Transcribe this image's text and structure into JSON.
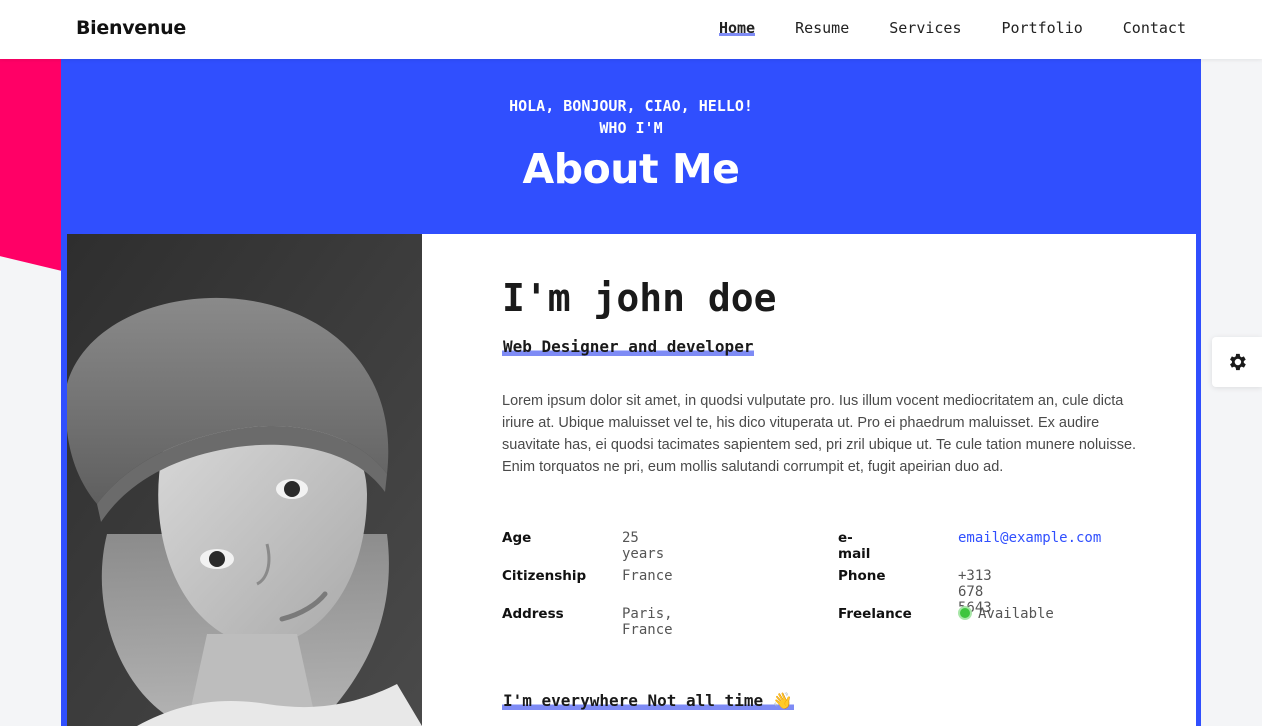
{
  "header": {
    "brand": "Bienvenue",
    "nav": [
      "Home",
      "Resume",
      "Services",
      "Portfolio",
      "Contact"
    ],
    "active_nav": "Home"
  },
  "hero": {
    "greeting": "HOLA, BONJOUR, CIAO, HELLO!",
    "subtitle": "WHO I'M",
    "title": "About Me"
  },
  "about": {
    "name": "I'm john doe",
    "role": "Web Designer and developer",
    "bio": "Lorem ipsum dolor sit amet, in quodsi vulputate pro. Ius illum vocent mediocritatem an, cule dicta iriure at. Ubique maluisset vel te, his dico vituperata ut. Pro ei phaedrum maluisset. Ex audire suavitate has, ei quodsi tacimates sapientem sed, pri zril ubique ut. Te cule tation munere noluisse. Enim torquatos ne pri, eum mollis salutandi corrumpit et, fugit apeirian duo ad.",
    "info": {
      "age_label": "Age",
      "age": "25 years",
      "citizenship_label": "Citizenship",
      "citizenship": "France",
      "address_label": "Address",
      "address": "Paris, France",
      "email_label": "e-mail",
      "email": "email@example.com",
      "phone_label": "Phone",
      "phone": "+313 678 5643",
      "freelance_label": "Freelance",
      "freelance": "Available"
    },
    "social_title": "I'm everywhere Not all time 👋"
  },
  "colors": {
    "accent": "#304ffe",
    "pink": "#ff0066",
    "highlight": "#7e8bf5",
    "available": "#3ec53e"
  },
  "icons": {
    "settings": "gear-icon",
    "status": "status-dot-icon"
  }
}
